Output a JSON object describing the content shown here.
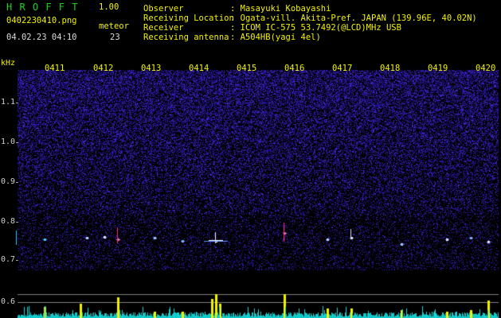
{
  "header": {
    "app_name": "H R O F F T",
    "version": "1.00",
    "filename": "0402230410.png",
    "datetime": "04.02.23 04:10",
    "meteor_label": "meteor",
    "meteor_count": "23",
    "observer_label": "Observer",
    "observer_value": ": Masayuki Kobayashi",
    "location_label": "Receiving Location",
    "location_value": ": Ogata-vill. Akita-Pref. JAPAN (139.96E, 40.02N)",
    "receiver_label": "Receiver",
    "receiver_value": ": ICOM IC-575 53.7492(@LCD)MHz USB",
    "antenna_label": "Receiving antenna",
    "antenna_value": ": A504HB(yagi 4el)"
  },
  "spectrogram": {
    "unit_label": "kHz",
    "time_ticks": [
      "0411",
      "0412",
      "0413",
      "0414",
      "0415",
      "0416",
      "0417",
      "0418",
      "0419",
      "0420"
    ],
    "freq_ticks": [
      "1.1",
      "1.0",
      "0.9",
      "0.8",
      "0.7",
      "0.6"
    ]
  },
  "colors": {
    "title_green": "#18d418",
    "yellow": "#f2f200",
    "cyan": "#18d4d4",
    "noise_blue": "#2a2ac8"
  }
}
